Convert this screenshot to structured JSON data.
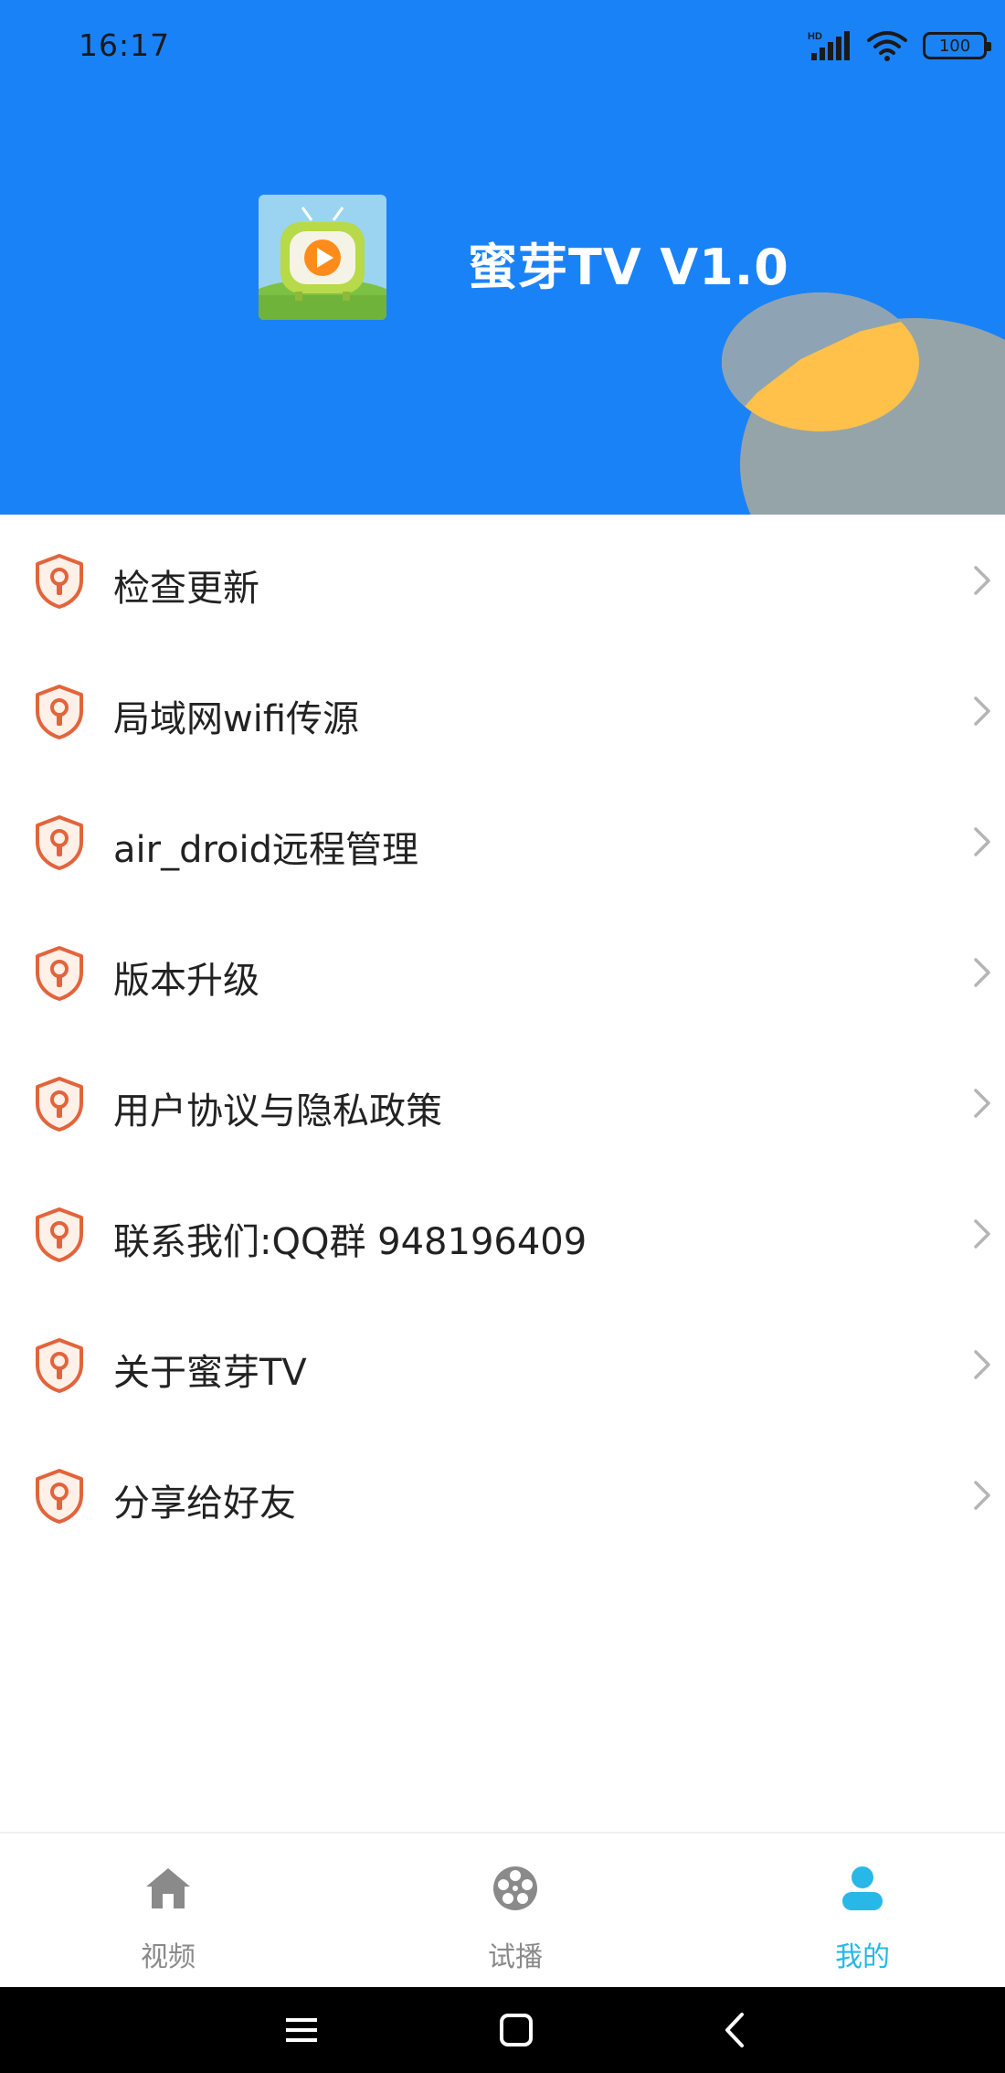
{
  "status_bar": {
    "time": "16:17",
    "battery": "100",
    "network_badge": "HD"
  },
  "header": {
    "app_title": "蜜芽TV V1.0",
    "background_color": "#1a82f7"
  },
  "menu": {
    "items": [
      {
        "label": "检查更新",
        "icon": "shield-keyhole-icon"
      },
      {
        "label": "局域网wifi传源",
        "icon": "shield-keyhole-icon"
      },
      {
        "label": "air_droid远程管理",
        "icon": "shield-keyhole-icon"
      },
      {
        "label": "版本升级",
        "icon": "shield-keyhole-icon"
      },
      {
        "label": "用户协议与隐私政策",
        "icon": "shield-keyhole-icon"
      },
      {
        "label": "联系我们:QQ群 948196409",
        "icon": "shield-keyhole-icon"
      },
      {
        "label": "关于蜜芽TV",
        "icon": "shield-keyhole-icon"
      },
      {
        "label": "分享给好友",
        "icon": "shield-keyhole-icon"
      }
    ]
  },
  "bottom_nav": {
    "tabs": [
      {
        "label": "视频",
        "icon": "home-icon",
        "active": false
      },
      {
        "label": "试播",
        "icon": "film-reel-icon",
        "active": false
      },
      {
        "label": "我的",
        "icon": "user-icon",
        "active": true
      }
    ],
    "active_color": "#27b8e8"
  },
  "system_nav": {
    "buttons": [
      "menu-icon",
      "home-square-icon",
      "back-icon"
    ]
  }
}
